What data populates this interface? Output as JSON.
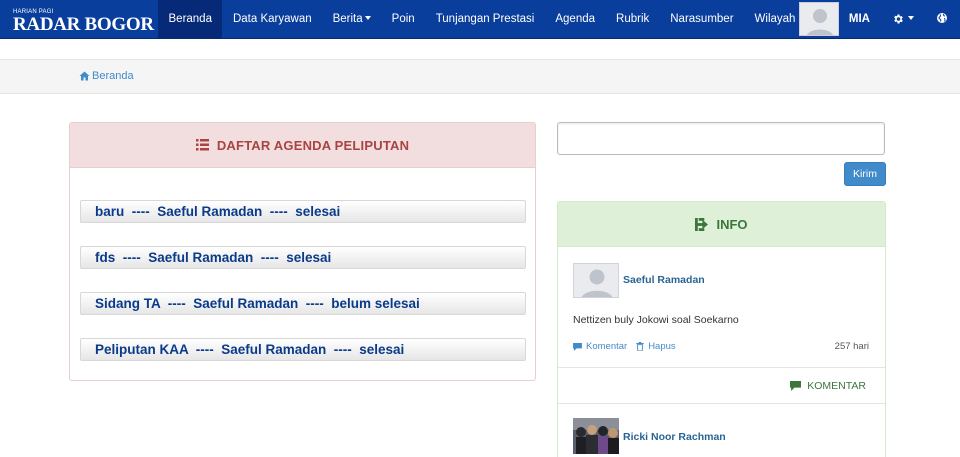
{
  "brand": {
    "tagline": "HARIAN PAGI",
    "name": "RADAR BOGOR"
  },
  "nav": {
    "items": [
      {
        "label": "Beranda",
        "active": true
      },
      {
        "label": "Data Karyawan"
      },
      {
        "label": "Berita",
        "dropdown": true
      },
      {
        "label": "Poin"
      },
      {
        "label": "Tunjangan Prestasi"
      },
      {
        "label": "Agenda"
      },
      {
        "label": "Rubrik"
      },
      {
        "label": "Narasumber"
      },
      {
        "label": "Wilayah"
      }
    ],
    "user_name": "MIA",
    "settings_icon": "gear-icon",
    "globe_icon": "globe-icon"
  },
  "breadcrumb": {
    "icon": "home-icon",
    "label": "Beranda"
  },
  "agenda": {
    "title": "DAFTAR AGENDA PELIPUTAN",
    "icon": "list-icon",
    "items": [
      {
        "text": "baru  ----  Saeful Ramadan  ----  selesai"
      },
      {
        "text": "fds  ----  Saeful Ramadan  ----  selesai"
      },
      {
        "text": "Sidang TA  ----  Saeful Ramadan  ----  belum selesai"
      },
      {
        "text": "Peliputan KAA  ----  Saeful Ramadan  ----  selesai"
      }
    ]
  },
  "form": {
    "input_value": "",
    "submit_label": "Kirim"
  },
  "info": {
    "title": "INFO",
    "icon": "share-icon",
    "posts": [
      {
        "author": "Saeful Ramadan",
        "text": "Nettizen buly Jokowi soal Soekarno",
        "comment_label": "Komentar",
        "delete_label": "Hapus",
        "age": "257 hari"
      },
      {
        "author": "Ricki Noor Rachman"
      }
    ],
    "komentar_label": "KOMENTAR"
  },
  "colors": {
    "navbar": "#0a3e9c",
    "danger_heading": "#a94442",
    "success_heading": "#3c763d",
    "link": "#428bca"
  }
}
